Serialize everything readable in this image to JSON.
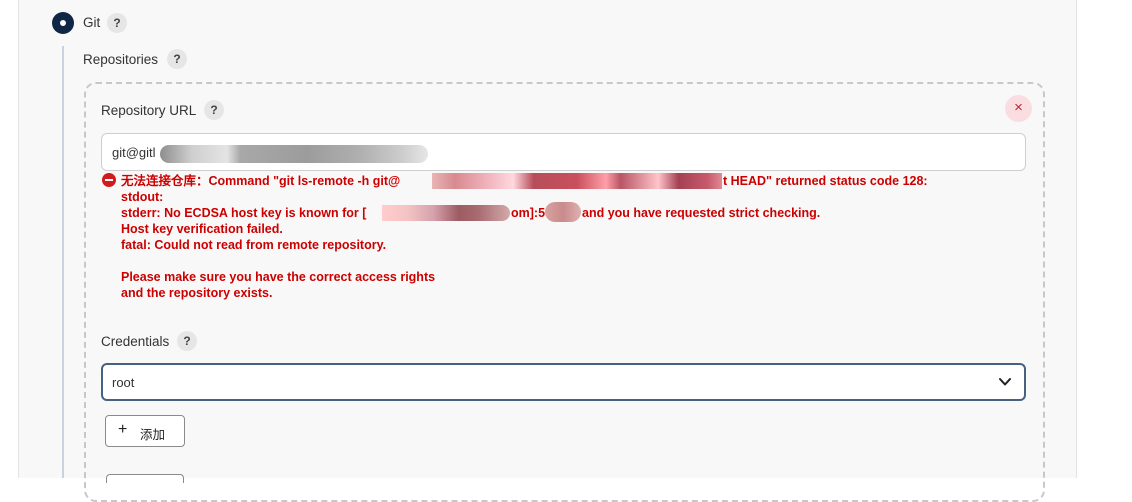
{
  "scm": {
    "option_label": "Git",
    "help": "?"
  },
  "repositories": {
    "label": "Repositories",
    "help": "?"
  },
  "repo_url": {
    "label": "Repository URL",
    "help": "?",
    "value": "git@gitl",
    "close_symbol": "×"
  },
  "error": {
    "line1_a": "无法连接仓库：Command \"git ls-remote -h git@",
    "line1_b": "t HEAD\" returned status code 128:",
    "line2": "stdout:",
    "line3_a": "stderr: No ECDSA host key is known for [",
    "line3_b": "om]:5",
    "line3_c": "and you have requested strict checking.",
    "line4": "Host key verification failed.",
    "line5": "fatal: Could not read from remote repository.",
    "line6": "Please make sure you have the correct access rights",
    "line7": "and the repository exists."
  },
  "credentials": {
    "label": "Credentials",
    "help": "?",
    "selected": "root"
  },
  "add_button": {
    "icon": "plus-icon",
    "label": "添加"
  },
  "colors": {
    "radio": "#0f2744",
    "error": "#cc0000",
    "select_border": "#46627f"
  }
}
